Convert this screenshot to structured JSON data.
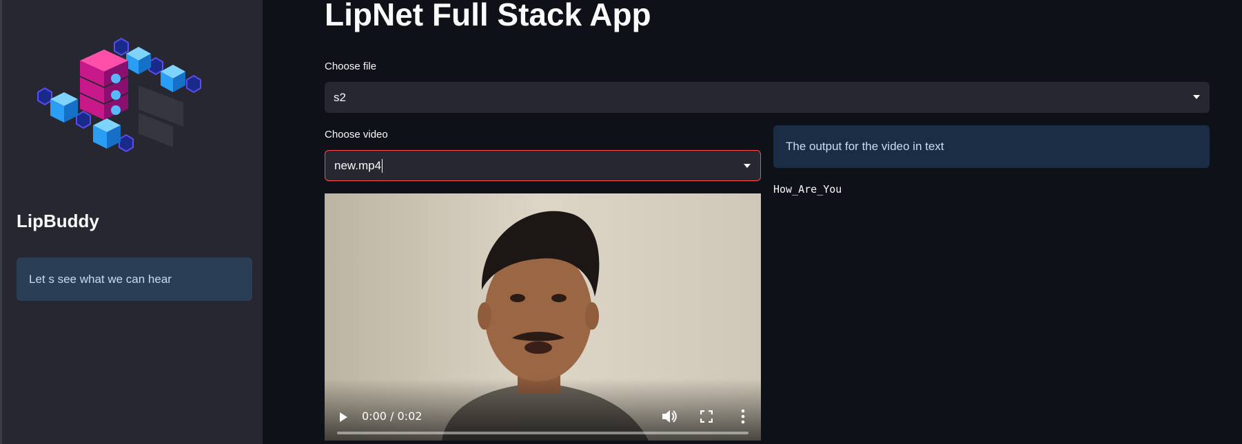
{
  "sidebar": {
    "logo_icon": "isometric-server-blocks-logo",
    "brand": "LipBuddy",
    "info": "Let s see what we can hear"
  },
  "main": {
    "title": "LipNet Full Stack App",
    "file_select": {
      "label": "Choose file",
      "value": "s2"
    },
    "video_select": {
      "label": "Choose video",
      "value": "new.mp4"
    },
    "video_player": {
      "time": "0:00 / 0:02",
      "progress": 0
    },
    "output": {
      "info": "The output for the video in text",
      "result": "How_Are_You"
    }
  },
  "colors": {
    "background": "#0e1117",
    "sidebar": "#262730",
    "info_box": "#1b2d45",
    "focus_border": "#ff4b4b"
  }
}
